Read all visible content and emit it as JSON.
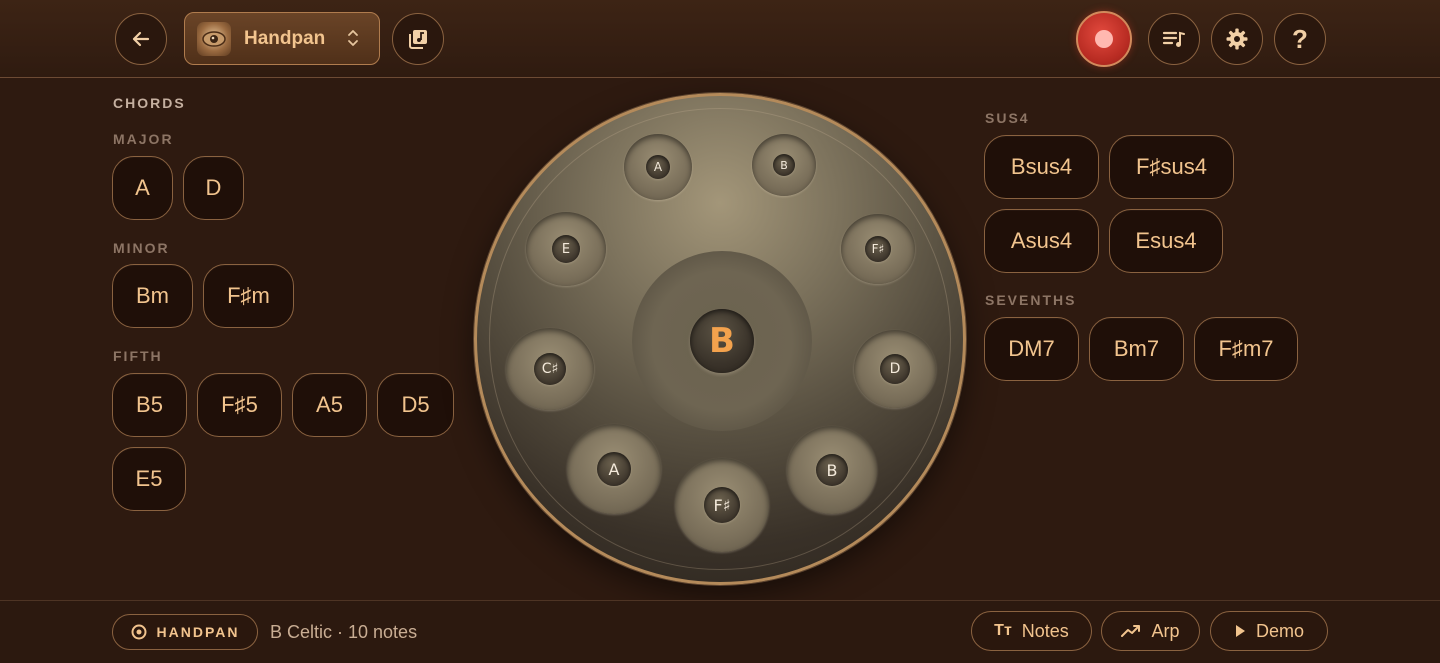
{
  "header": {
    "instrument": "Handpan",
    "icons": {
      "back": "back-arrow-icon",
      "library": "library-icon",
      "record": "record-icon",
      "playlist": "playlist-icon",
      "settings": "gear-icon",
      "help": "help-icon"
    },
    "colors": {
      "record": "#c93127",
      "accent": "#f3a24d"
    }
  },
  "chords": {
    "title": "CHORDS",
    "major": {
      "label": "MAJOR",
      "items": [
        "A",
        "D"
      ]
    },
    "minor": {
      "label": "MINOR",
      "items": [
        "Bm",
        "F♯m"
      ]
    },
    "fifth": {
      "label": "FIFTH",
      "items": [
        "B5",
        "F♯5",
        "A5",
        "D5",
        "E5"
      ]
    },
    "sus4": {
      "label": "SUS4",
      "items": [
        "Bsus4",
        "F♯sus4",
        "Asus4",
        "Esus4"
      ]
    },
    "sevenths": {
      "label": "SEVENTHS",
      "items": [
        "DM7",
        "Bm7",
        "F♯m7"
      ]
    }
  },
  "handpan": {
    "ding": "B",
    "notes": [
      "A",
      "B",
      "E",
      "F♯",
      "C♯",
      "D",
      "A",
      "B",
      "F♯"
    ]
  },
  "footer": {
    "badge": "HANDPAN",
    "scale": "B Celtic · 10 notes",
    "notes_btn": "Notes",
    "arp_btn": "Arp",
    "demo_btn": "Demo"
  }
}
